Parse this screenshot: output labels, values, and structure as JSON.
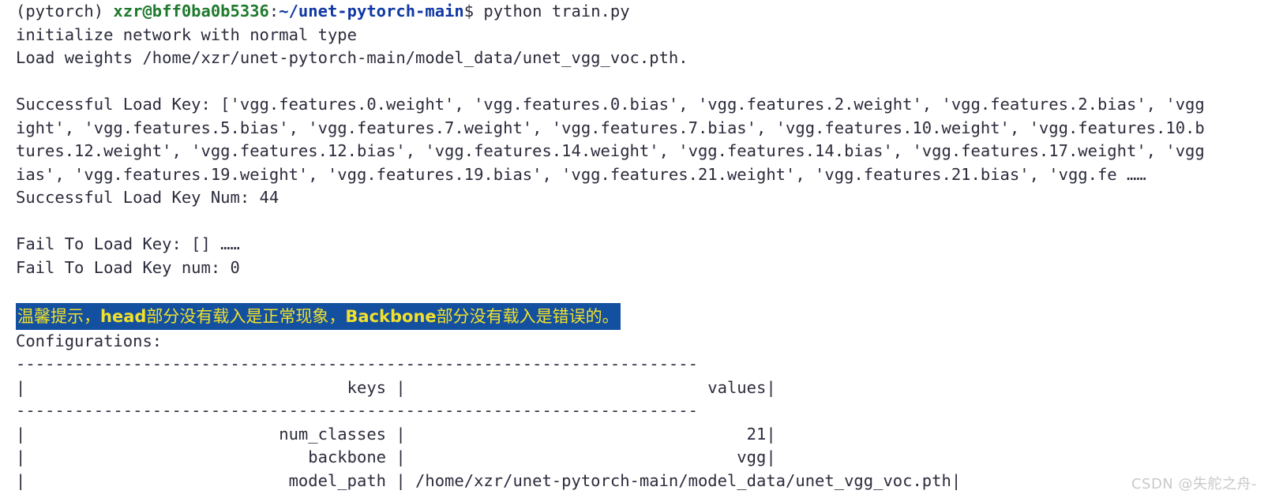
{
  "terminal": {
    "background_color": "#ffffff",
    "foreground_color": "#2b2b3c",
    "prompt": {
      "env": "(pytorch) ",
      "user_host": "xzr@bff0ba0b5336",
      "colon": ":",
      "path": "~/unet-pytorch-main",
      "sigil_and_command": "$ python train.py",
      "user_host_color": "#1f7a2e",
      "path_color": "#1038a5"
    },
    "lines": [
      "initialize network with normal type",
      "Load weights /home/xzr/unet-pytorch-main/model_data/unet_vgg_voc.pth.",
      "",
      "Successful Load Key: ['vgg.features.0.weight', 'vgg.features.0.bias', 'vgg.features.2.weight', 'vgg.features.2.bias', 'vgg",
      "ight', 'vgg.features.5.bias', 'vgg.features.7.weight', 'vgg.features.7.bias', 'vgg.features.10.weight', 'vgg.features.10.b",
      "tures.12.weight', 'vgg.features.12.bias', 'vgg.features.14.weight', 'vgg.features.14.bias', 'vgg.features.17.weight', 'vgg",
      "ias', 'vgg.features.19.weight', 'vgg.features.19.bias', 'vgg.features.21.weight', 'vgg.features.21.bias', 'vgg.fe ……",
      "Successful Load Key Num: 44",
      "",
      "Fail To Load Key: [] ……",
      "Fail To Load Key num: 0",
      ""
    ],
    "tip": {
      "text_prefix": "温馨提示，",
      "bold_head": "head",
      "text_middle": "部分没有载入是正常现象，",
      "bold_backbone": "Backbone",
      "text_suffix": "部分没有载入是错误的。",
      "background_color": "#1350a0",
      "text_color": "#f2e12a"
    },
    "config": {
      "heading": "Configurations:",
      "separator": "----------------------------------------------------------------------",
      "header_row": "|                                 keys |                               values|",
      "rows": [
        "|                          num_classes |                                   21|",
        "|                             backbone |                                  vgg|",
        "|                           model_path | /home/xzr/unet-pytorch-main/model_data/unet_vgg_voc.pth|"
      ]
    }
  },
  "watermark": {
    "text": "CSDN @失舵之舟-"
  }
}
